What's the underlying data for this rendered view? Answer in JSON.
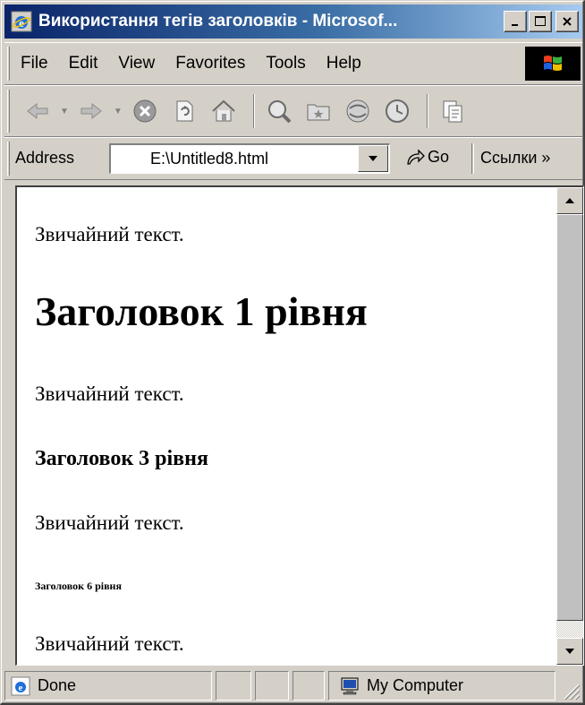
{
  "window": {
    "title": "Використання тегів заголовків - Microsof...",
    "minimize_label": "_",
    "maximize_label": "□",
    "close_label": "✕"
  },
  "menu": {
    "items": [
      "File",
      "Edit",
      "View",
      "Favorites",
      "Tools",
      "Help"
    ]
  },
  "toolbar": {
    "icons": [
      "back-icon",
      "forward-icon",
      "stop-icon",
      "refresh-icon",
      "home-icon",
      "search-icon",
      "favorites-icon",
      "media-icon",
      "history-icon",
      "page-icon"
    ]
  },
  "address": {
    "label": "Address",
    "value": "E:\\Untitled8.html",
    "go_label": "Go",
    "links_label": "Ссылки »"
  },
  "content": {
    "paragraph_1": "Звичайний текст.",
    "heading_1": "Заголовок 1 рівня",
    "paragraph_2": "Звичайний текст.",
    "heading_3": "Заголовок 3 рівня",
    "paragraph_3": "Звичайний текст.",
    "heading_6": "Заголовок 6 рівня",
    "paragraph_4": "Звичайний текст."
  },
  "status": {
    "text": "Done",
    "zone": "My Computer"
  },
  "colors": {
    "titlebar_start": "#0a246a",
    "titlebar_end": "#a6caf0",
    "chrome": "#d4d0c8"
  }
}
